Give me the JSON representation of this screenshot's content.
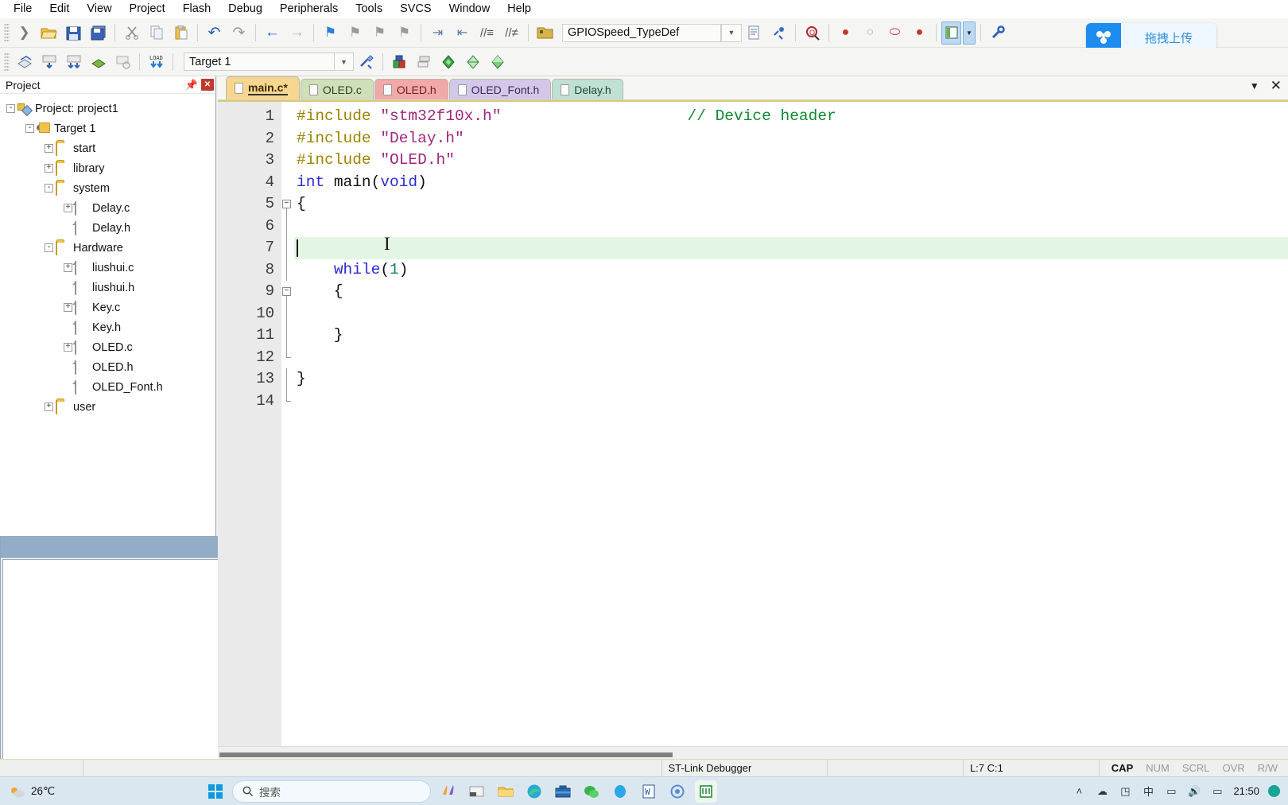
{
  "menubar": {
    "items": [
      {
        "label": "File"
      },
      {
        "label": "Edit"
      },
      {
        "label": "View"
      },
      {
        "label": "Project"
      },
      {
        "label": "Flash"
      },
      {
        "label": "Debug"
      },
      {
        "label": "Peripherals"
      },
      {
        "label": "Tools"
      },
      {
        "label": "SVCS"
      },
      {
        "label": "Window"
      },
      {
        "label": "Help"
      }
    ]
  },
  "toolbar1": {
    "icons": [
      {
        "name": "new-file-icon",
        "glyph": "❯"
      },
      {
        "name": "open-file-icon",
        "glyph": "📂"
      },
      {
        "name": "save-icon",
        "glyph": "💾"
      },
      {
        "name": "save-all-icon",
        "glyph": "💾"
      },
      {
        "name": "cut-icon",
        "glyph": "✂"
      },
      {
        "name": "copy-icon",
        "glyph": "⧉"
      },
      {
        "name": "paste-icon",
        "glyph": "📋"
      },
      {
        "name": "undo-icon",
        "glyph": "↶"
      },
      {
        "name": "redo-icon",
        "glyph": "↷"
      },
      {
        "name": "navigate-back-icon",
        "glyph": "←"
      },
      {
        "name": "navigate-forward-icon",
        "glyph": "→"
      },
      {
        "name": "bookmark-toggle-icon",
        "glyph": "⚑"
      },
      {
        "name": "bookmark-prev-icon",
        "glyph": "⚑"
      },
      {
        "name": "bookmark-next-icon",
        "glyph": "⚑"
      },
      {
        "name": "bookmark-clear-icon",
        "glyph": "⚑"
      },
      {
        "name": "indent-icon",
        "glyph": "⇥"
      },
      {
        "name": "outdent-icon",
        "glyph": "⇤"
      },
      {
        "name": "comment-icon",
        "glyph": "≡"
      },
      {
        "name": "uncomment-icon",
        "glyph": "≡"
      },
      {
        "name": "open-folder-icon",
        "glyph": "📁"
      }
    ],
    "function_combo_value": "GPIOSpeed_TypeDef",
    "right_icons": [
      {
        "name": "file-properties-icon",
        "glyph": "📄"
      },
      {
        "name": "configure-icon",
        "glyph": "🔧"
      },
      {
        "name": "find-in-files-icon",
        "glyph": "🔍"
      },
      {
        "name": "insert-breakpoint-icon",
        "glyph": "●"
      },
      {
        "name": "remove-breakpoint-icon",
        "glyph": "○"
      },
      {
        "name": "disable-breakpoint-icon",
        "glyph": "⬭"
      },
      {
        "name": "kill-all-breakpoints-icon",
        "glyph": "●"
      },
      {
        "name": "project-window-icon",
        "glyph": "▤"
      },
      {
        "name": "project-window-dropdown-icon",
        "glyph": "▼"
      },
      {
        "name": "configuration-wizard-icon",
        "glyph": "🔧"
      }
    ]
  },
  "toolbar2": {
    "icons": [
      {
        "name": "translate-icon",
        "glyph": "◈"
      },
      {
        "name": "build-icon",
        "glyph": "⬇"
      },
      {
        "name": "rebuild-icon",
        "glyph": "⬇"
      },
      {
        "name": "batch-build-icon",
        "glyph": "◈"
      },
      {
        "name": "stop-build-icon",
        "glyph": "▣"
      },
      {
        "name": "download-icon",
        "glyph": "⬇"
      }
    ],
    "target_value": "Target 1",
    "target_dropdown_icon": "chevron-down-icon",
    "right_icons": [
      {
        "name": "target-options-icon",
        "glyph": "⚒"
      },
      {
        "name": "manage-project-items-icon",
        "glyph": "▤"
      },
      {
        "name": "manage-multi-project-icon",
        "glyph": "❐"
      },
      {
        "name": "pack-installer-icon",
        "glyph": "◆"
      },
      {
        "name": "manage-run-time-icon",
        "glyph": "◇"
      },
      {
        "name": "select-software-packs-icon",
        "glyph": "◈"
      }
    ]
  },
  "baidu_widget": {
    "label": "拖拽上传",
    "logo_icon": "baidu-netdisk-icon",
    "accent_color": "#1c8cf0"
  },
  "project_panel": {
    "title": "Project",
    "pin_icon": "pin-icon",
    "close_icon": "close-icon",
    "tree": [
      {
        "label": "Project: project1",
        "depth": 0,
        "icon": "project-icon",
        "expander": "-"
      },
      {
        "label": "Target 1",
        "depth": 1,
        "icon": "target-icon",
        "expander": "-"
      },
      {
        "label": "start",
        "depth": 2,
        "icon": "folder-icon",
        "expander": "+"
      },
      {
        "label": "library",
        "depth": 2,
        "icon": "folder-icon",
        "expander": "+"
      },
      {
        "label": "system",
        "depth": 2,
        "icon": "folder-open-icon",
        "expander": "-"
      },
      {
        "label": "Delay.c",
        "depth": 3,
        "icon": "c-file-icon",
        "expander": "+"
      },
      {
        "label": "Delay.h",
        "depth": 3,
        "icon": "h-file-icon",
        "expander": ""
      },
      {
        "label": "Hardware",
        "depth": 2,
        "icon": "folder-open-icon",
        "expander": "-"
      },
      {
        "label": "liushui.c",
        "depth": 3,
        "icon": "c-file-icon",
        "expander": "+"
      },
      {
        "label": "liushui.h",
        "depth": 3,
        "icon": "h-file-icon",
        "expander": ""
      },
      {
        "label": "Key.c",
        "depth": 3,
        "icon": "c-file-icon",
        "expander": "+"
      },
      {
        "label": "Key.h",
        "depth": 3,
        "icon": "h-file-icon",
        "expander": ""
      },
      {
        "label": "OLED.c",
        "depth": 3,
        "icon": "c-file-icon",
        "expander": "+"
      },
      {
        "label": "OLED.h",
        "depth": 3,
        "icon": "h-file-icon",
        "expander": ""
      },
      {
        "label": "OLED_Font.h",
        "depth": 3,
        "icon": "h-file-icon",
        "expander": ""
      },
      {
        "label": "user",
        "depth": 2,
        "icon": "folder-icon",
        "expander": "+"
      }
    ]
  },
  "build_panel": {
    "title": "",
    "close_icon": "close-icon",
    "content": "",
    "scroll_up_icon": "▲",
    "scroll_down_icon": "▼"
  },
  "editor": {
    "tabs": [
      {
        "label": "main.c*",
        "active": true,
        "bg": "#f7d78f",
        "fg": "#3a2a00"
      },
      {
        "label": "OLED.c",
        "active": false,
        "bg": "#cfdfb8",
        "fg": "#2f4418"
      },
      {
        "label": "OLED.h",
        "active": false,
        "bg": "#f0a8a8",
        "fg": "#7a1e1e"
      },
      {
        "label": "OLED_Font.h",
        "active": false,
        "bg": "#d3c8e8",
        "fg": "#3a2a5a"
      },
      {
        "label": "Delay.h",
        "active": false,
        "bg": "#bfe0d2",
        "fg": "#1e4a3a"
      }
    ],
    "tabbar_dropdown_icon": "chevron-down-icon",
    "tabbar_close_icon": "close-icon",
    "current_line": 7,
    "lines": [
      {
        "n": 1,
        "fold": "",
        "tokens": [
          {
            "t": "#include ",
            "c": "pre"
          },
          {
            "t": "\"stm32f10x.h\"",
            "c": "str"
          },
          {
            "t": "                    ",
            "c": "pl"
          },
          {
            "t": "// Device header",
            "c": "cmt"
          }
        ]
      },
      {
        "n": 2,
        "fold": "",
        "tokens": [
          {
            "t": "#include ",
            "c": "pre"
          },
          {
            "t": "\"Delay.h\"",
            "c": "str"
          }
        ]
      },
      {
        "n": 3,
        "fold": "",
        "tokens": [
          {
            "t": "#include ",
            "c": "pre"
          },
          {
            "t": "\"OLED.h\"",
            "c": "str"
          }
        ]
      },
      {
        "n": 4,
        "fold": "",
        "tokens": [
          {
            "t": "int ",
            "c": "kw"
          },
          {
            "t": "main(",
            "c": "pl"
          },
          {
            "t": "void",
            "c": "kw"
          },
          {
            "t": ")",
            "c": "pl"
          }
        ]
      },
      {
        "n": 5,
        "fold": "box",
        "tokens": [
          {
            "t": "{",
            "c": "pl"
          }
        ]
      },
      {
        "n": 6,
        "fold": "line",
        "tokens": []
      },
      {
        "n": 7,
        "fold": "line",
        "tokens": []
      },
      {
        "n": 8,
        "fold": "line",
        "tokens": [
          {
            "t": "    ",
            "c": "pl"
          },
          {
            "t": "while",
            "c": "kw"
          },
          {
            "t": "(",
            "c": "pl"
          },
          {
            "t": "1",
            "c": "num"
          },
          {
            "t": ")",
            "c": "pl"
          }
        ]
      },
      {
        "n": 9,
        "fold": "box",
        "tokens": [
          {
            "t": "    {",
            "c": "pl"
          }
        ]
      },
      {
        "n": 10,
        "fold": "line",
        "tokens": []
      },
      {
        "n": 11,
        "fold": "line",
        "tokens": [
          {
            "t": "    }",
            "c": "pl"
          }
        ]
      },
      {
        "n": 12,
        "fold": "end",
        "tokens": []
      },
      {
        "n": 13,
        "fold": "line",
        "tokens": [
          {
            "t": "}",
            "c": "pl"
          }
        ]
      },
      {
        "n": 14,
        "fold": "end",
        "tokens": []
      }
    ]
  },
  "statusbar": {
    "debugger": "ST-Link Debugger",
    "position": "L:7 C:1",
    "flags": [
      {
        "label": "CAP",
        "on": true
      },
      {
        "label": "NUM",
        "on": false
      },
      {
        "label": "SCRL",
        "on": false
      },
      {
        "label": "OVR",
        "on": false
      },
      {
        "label": "R/W",
        "on": false
      }
    ]
  },
  "taskbar": {
    "weather_icon": "partly-cloudy-icon",
    "temperature": "26℃",
    "start_icon": "windows-start-icon",
    "search_icon": "search-icon",
    "search_placeholder": "搜索",
    "apps": [
      {
        "name": "taskview-icon",
        "glyph": "❖"
      },
      {
        "name": "widgets-icon",
        "glyph": "▣"
      },
      {
        "name": "file-explorer-icon",
        "glyph": "📁"
      },
      {
        "name": "edge-browser-icon",
        "glyph": "◑"
      },
      {
        "name": "toolbox-icon",
        "glyph": "💼"
      },
      {
        "name": "wechat-icon",
        "glyph": "●"
      },
      {
        "name": "qq-icon",
        "glyph": "●"
      },
      {
        "name": "word-icon",
        "glyph": "W"
      },
      {
        "name": "browser-icon",
        "glyph": "◎"
      },
      {
        "name": "keil-uvision-icon",
        "glyph": "μ"
      }
    ],
    "tray": [
      {
        "name": "hidden-icons-icon",
        "glyph": "˄"
      },
      {
        "name": "cloud-sync-icon",
        "glyph": "☁"
      },
      {
        "name": "network-icon",
        "glyph": "◳"
      },
      {
        "name": "ime-icon",
        "glyph": "中"
      },
      {
        "name": "battery-icon",
        "glyph": "▭"
      },
      {
        "name": "volume-icon",
        "glyph": "🔊"
      },
      {
        "name": "display-icon",
        "glyph": "▭"
      }
    ],
    "clock": "21:50",
    "notification_icon": "notification-icon"
  }
}
